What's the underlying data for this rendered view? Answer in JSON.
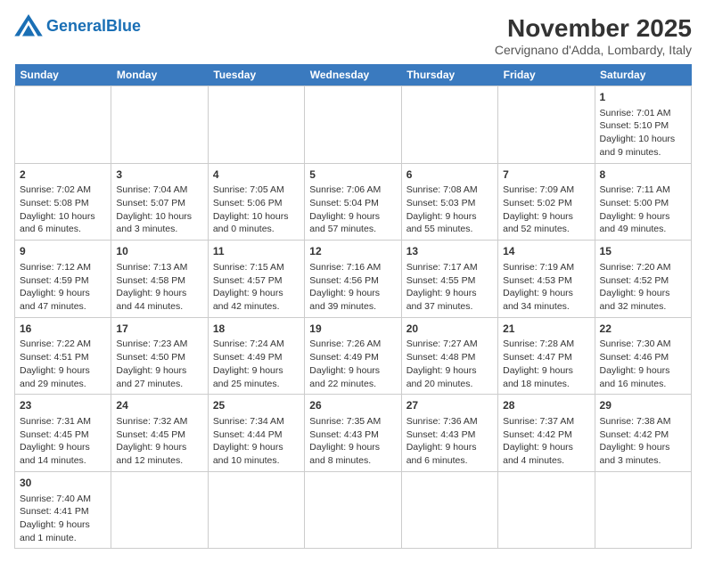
{
  "header": {
    "logo_general": "General",
    "logo_blue": "Blue",
    "month_title": "November 2025",
    "location": "Cervignano d'Adda, Lombardy, Italy"
  },
  "days_of_week": [
    "Sunday",
    "Monday",
    "Tuesday",
    "Wednesday",
    "Thursday",
    "Friday",
    "Saturday"
  ],
  "weeks": [
    {
      "cells": [
        {
          "day": null,
          "text": ""
        },
        {
          "day": null,
          "text": ""
        },
        {
          "day": null,
          "text": ""
        },
        {
          "day": null,
          "text": ""
        },
        {
          "day": null,
          "text": ""
        },
        {
          "day": null,
          "text": ""
        },
        {
          "day": "1",
          "text": "Sunrise: 7:01 AM\nSunset: 5:10 PM\nDaylight: 10 hours and 9 minutes."
        }
      ]
    },
    {
      "cells": [
        {
          "day": "2",
          "text": "Sunrise: 7:02 AM\nSunset: 5:08 PM\nDaylight: 10 hours and 6 minutes."
        },
        {
          "day": "3",
          "text": "Sunrise: 7:04 AM\nSunset: 5:07 PM\nDaylight: 10 hours and 3 minutes."
        },
        {
          "day": "4",
          "text": "Sunrise: 7:05 AM\nSunset: 5:06 PM\nDaylight: 10 hours and 0 minutes."
        },
        {
          "day": "5",
          "text": "Sunrise: 7:06 AM\nSunset: 5:04 PM\nDaylight: 9 hours and 57 minutes."
        },
        {
          "day": "6",
          "text": "Sunrise: 7:08 AM\nSunset: 5:03 PM\nDaylight: 9 hours and 55 minutes."
        },
        {
          "day": "7",
          "text": "Sunrise: 7:09 AM\nSunset: 5:02 PM\nDaylight: 9 hours and 52 minutes."
        },
        {
          "day": "8",
          "text": "Sunrise: 7:11 AM\nSunset: 5:00 PM\nDaylight: 9 hours and 49 minutes."
        }
      ]
    },
    {
      "cells": [
        {
          "day": "9",
          "text": "Sunrise: 7:12 AM\nSunset: 4:59 PM\nDaylight: 9 hours and 47 minutes."
        },
        {
          "day": "10",
          "text": "Sunrise: 7:13 AM\nSunset: 4:58 PM\nDaylight: 9 hours and 44 minutes."
        },
        {
          "day": "11",
          "text": "Sunrise: 7:15 AM\nSunset: 4:57 PM\nDaylight: 9 hours and 42 minutes."
        },
        {
          "day": "12",
          "text": "Sunrise: 7:16 AM\nSunset: 4:56 PM\nDaylight: 9 hours and 39 minutes."
        },
        {
          "day": "13",
          "text": "Sunrise: 7:17 AM\nSunset: 4:55 PM\nDaylight: 9 hours and 37 minutes."
        },
        {
          "day": "14",
          "text": "Sunrise: 7:19 AM\nSunset: 4:53 PM\nDaylight: 9 hours and 34 minutes."
        },
        {
          "day": "15",
          "text": "Sunrise: 7:20 AM\nSunset: 4:52 PM\nDaylight: 9 hours and 32 minutes."
        }
      ]
    },
    {
      "cells": [
        {
          "day": "16",
          "text": "Sunrise: 7:22 AM\nSunset: 4:51 PM\nDaylight: 9 hours and 29 minutes."
        },
        {
          "day": "17",
          "text": "Sunrise: 7:23 AM\nSunset: 4:50 PM\nDaylight: 9 hours and 27 minutes."
        },
        {
          "day": "18",
          "text": "Sunrise: 7:24 AM\nSunset: 4:49 PM\nDaylight: 9 hours and 25 minutes."
        },
        {
          "day": "19",
          "text": "Sunrise: 7:26 AM\nSunset: 4:49 PM\nDaylight: 9 hours and 22 minutes."
        },
        {
          "day": "20",
          "text": "Sunrise: 7:27 AM\nSunset: 4:48 PM\nDaylight: 9 hours and 20 minutes."
        },
        {
          "day": "21",
          "text": "Sunrise: 7:28 AM\nSunset: 4:47 PM\nDaylight: 9 hours and 18 minutes."
        },
        {
          "day": "22",
          "text": "Sunrise: 7:30 AM\nSunset: 4:46 PM\nDaylight: 9 hours and 16 minutes."
        }
      ]
    },
    {
      "cells": [
        {
          "day": "23",
          "text": "Sunrise: 7:31 AM\nSunset: 4:45 PM\nDaylight: 9 hours and 14 minutes."
        },
        {
          "day": "24",
          "text": "Sunrise: 7:32 AM\nSunset: 4:45 PM\nDaylight: 9 hours and 12 minutes."
        },
        {
          "day": "25",
          "text": "Sunrise: 7:34 AM\nSunset: 4:44 PM\nDaylight: 9 hours and 10 minutes."
        },
        {
          "day": "26",
          "text": "Sunrise: 7:35 AM\nSunset: 4:43 PM\nDaylight: 9 hours and 8 minutes."
        },
        {
          "day": "27",
          "text": "Sunrise: 7:36 AM\nSunset: 4:43 PM\nDaylight: 9 hours and 6 minutes."
        },
        {
          "day": "28",
          "text": "Sunrise: 7:37 AM\nSunset: 4:42 PM\nDaylight: 9 hours and 4 minutes."
        },
        {
          "day": "29",
          "text": "Sunrise: 7:38 AM\nSunset: 4:42 PM\nDaylight: 9 hours and 3 minutes."
        }
      ]
    },
    {
      "cells": [
        {
          "day": "30",
          "text": "Sunrise: 7:40 AM\nSunset: 4:41 PM\nDaylight: 9 hours and 1 minute."
        },
        {
          "day": null,
          "text": ""
        },
        {
          "day": null,
          "text": ""
        },
        {
          "day": null,
          "text": ""
        },
        {
          "day": null,
          "text": ""
        },
        {
          "day": null,
          "text": ""
        },
        {
          "day": null,
          "text": ""
        }
      ]
    }
  ]
}
